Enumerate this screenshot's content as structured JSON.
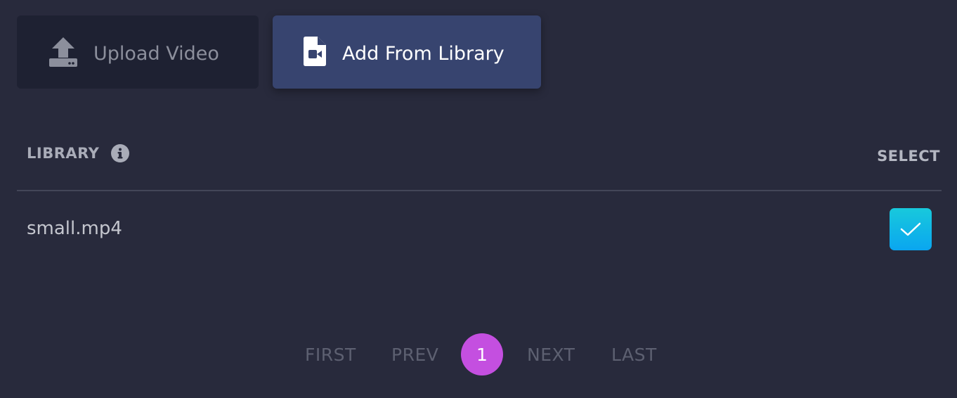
{
  "tabs": {
    "upload": {
      "label": "Upload Video",
      "icon": "upload-icon"
    },
    "library": {
      "label": "Add From Library",
      "icon": "video-file-icon",
      "active": true
    }
  },
  "library": {
    "title": "LIBRARY",
    "info_icon": "info-icon",
    "select_header": "SELECT",
    "rows": [
      {
        "name": "small.mp4",
        "selected": true
      }
    ]
  },
  "pagination": {
    "first": "FIRST",
    "prev": "PREV",
    "current": "1",
    "next": "NEXT",
    "last": "LAST"
  },
  "colors": {
    "background": "#282a3c",
    "active_tab": "#37446f",
    "inactive_tab": "#1e2132",
    "checkbox": "#0aa6f0",
    "current_page": "#c44fe0"
  }
}
